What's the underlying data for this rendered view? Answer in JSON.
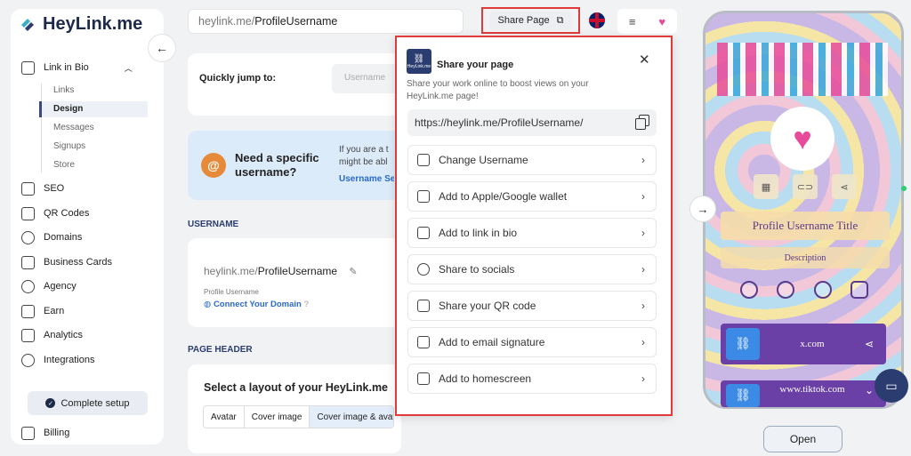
{
  "sidebar": {
    "logo": "HeyLink.me",
    "link_in_bio": "Link in Bio",
    "sub_items": [
      "Links",
      "Design",
      "Messages",
      "Signups",
      "Store"
    ],
    "items": [
      "SEO",
      "QR Codes",
      "Domains",
      "Business Cards",
      "Agency",
      "Earn",
      "Analytics",
      "Integrations"
    ],
    "complete_setup": "Complete setup",
    "billing": "Billing"
  },
  "topbar": {
    "url_prefix": "heylink.me/",
    "url_user": "ProfileUsername",
    "share_label": "Share Page"
  },
  "main": {
    "jump_label": "Quickly jump to:",
    "jump_placeholder": "Username",
    "need_title": "Need a specific username?",
    "need_text": "If you are a t might be abl",
    "need_link": "Username Se",
    "section_username": "USERNAME",
    "username_prefix": "heylink.me/",
    "username_value": "ProfileUsername",
    "username_label": "Profile Username",
    "connect_domain": "Connect Your Domain",
    "section_header": "PAGE HEADER",
    "layout_title": "Select a layout of your HeyLink.me",
    "layout_options": [
      "Avatar",
      "Cover image",
      "Cover image & avatar"
    ]
  },
  "popup": {
    "logo_text": "HeyLink.me",
    "title": "Share your page",
    "description": "Share your work online to boost views on your HeyLink.me page!",
    "url": "https://heylink.me/ProfileUsername/",
    "options": [
      "Change Username",
      "Add to Apple/Google wallet",
      "Add to link in bio",
      "Share to socials",
      "Share your QR code",
      "Add to email signature",
      "Add to homescreen"
    ]
  },
  "preview": {
    "profile_title": "Profile Username Title",
    "description": "Description",
    "links": [
      "x.com",
      "www.tiktok.com"
    ],
    "open_label": "Open"
  },
  "colors": {
    "accent": "#2b3d70",
    "highlight": "#e03a3a",
    "link": "#2a6ac8"
  }
}
